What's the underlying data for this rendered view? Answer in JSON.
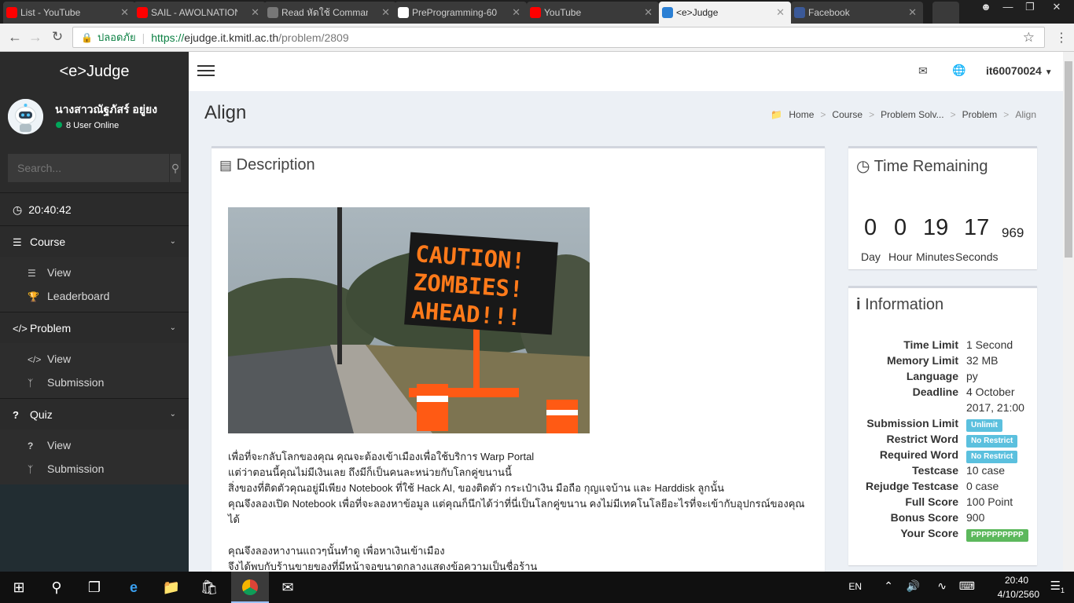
{
  "browser": {
    "tabs": [
      {
        "title": "List - YouTube",
        "icon": "youtube-icon",
        "color": "#ff0000"
      },
      {
        "title": "SAIL - AWOLNATION",
        "icon": "youtube-icon",
        "color": "#ff0000"
      },
      {
        "title": "Read หัดใช้ Command",
        "icon": "book-icon",
        "color": "#777777"
      },
      {
        "title": "PreProgramming-60",
        "icon": "github-icon",
        "color": "#ffffff"
      },
      {
        "title": "YouTube",
        "icon": "youtube-icon",
        "color": "#ff0000"
      },
      {
        "title": "<e>Judge",
        "icon": "itkmitl-icon",
        "color": "#2a7fd4"
      },
      {
        "title": "Facebook",
        "icon": "facebook-icon",
        "color": "#3b5998"
      }
    ],
    "address": {
      "secure_label": "ปลอดภัย",
      "scheme": "https://",
      "host": "ejudge.it.kmitl.ac.th",
      "path": "/problem/2809"
    }
  },
  "sidebar": {
    "logo": "<e>Judge",
    "user_name": "นางสาวณัฐภัสร์ อยู่ยง",
    "online": "8 User Online",
    "search_placeholder": "Search...",
    "clock": "20:40:42",
    "sections": [
      {
        "label": "Course",
        "items": [
          "View",
          "Leaderboard"
        ]
      },
      {
        "label": "Problem",
        "items": [
          "View",
          "Submission"
        ]
      },
      {
        "label": "Quiz",
        "items": [
          "View",
          "Submission"
        ]
      }
    ]
  },
  "topnav": {
    "user": "it60070024"
  },
  "page": {
    "title": "Align",
    "breadcrumb": [
      "Home",
      "Course",
      "Problem Solv...",
      "Problem",
      "Align"
    ]
  },
  "description": {
    "heading": "Description",
    "sign_text": [
      "CAUTION!",
      "ZOMBIES!",
      "AHEAD!!!"
    ],
    "paragraphs": [
      "เพื่อที่จะกลับโลกของคุณ คุณจะต้องเข้าเมืองเพื่อใช้บริการ Warp Portal",
      "แต่ว่าตอนนี้คุณไม่มีเงินเลย ถึงมีก็เป็นคนละหน่วยกับโลกคู่ขนานนี้",
      "สิ่งของที่ติดตัวคุณอยู่มีเพียง Notebook ที่ใช้ Hack AI, ของติดตัว กระเป๋าเงิน มือถือ กุญแจบ้าน และ Harddisk ลูกนั้น",
      "คุณจึงลองเปิด Notebook เพื่อที่จะลองหาข้อมูล แต่คุณก็นึกได้ว่าที่นี่เป็นโลกคู่ขนาน คงไม่มีเทคโนโลยีอะไรที่จะเข้ากับอุปกรณ์ของคุณได้",
      "",
      "คุณจึงลองหางานแถวๆนั้นทำดู เพื่อหาเงินเข้าเมือง",
      "จึงได้พบกับร้านขายของที่มีหน้าจอขนาดกลางแสดงข้อความเป็นชื่อร้าน"
    ]
  },
  "time_remaining": {
    "heading": "Time Remaining",
    "day": "0",
    "hour": "0",
    "minutes": "19",
    "seconds": "17",
    "ms": "969",
    "labels": {
      "day": "Day",
      "hour": "Hour",
      "minutes": "Minutes",
      "seconds": "Seconds"
    }
  },
  "information": {
    "heading": "Information",
    "rows": [
      {
        "k": "Time Limit",
        "v": "1 Second"
      },
      {
        "k": "Memory Limit",
        "v": "32 MB"
      },
      {
        "k": "Language",
        "v": "py"
      },
      {
        "k": "Deadline",
        "v": "4 October",
        "v2": "2017, 21:00"
      },
      {
        "k": "Submission Limit",
        "badge": "Unlimit",
        "color": "#5bc0de"
      },
      {
        "k": "Restrict Word",
        "badge": "No Restrict",
        "color": "#5bc0de"
      },
      {
        "k": "Required Word",
        "badge": "No Restrict",
        "color": "#5bc0de"
      },
      {
        "k": "Testcase",
        "v": "10 case"
      },
      {
        "k": "Rejudge Testcase",
        "v": "0 case"
      },
      {
        "k": "Full Score",
        "v": "100 Point"
      },
      {
        "k": "Bonus Score",
        "v": "900"
      },
      {
        "k": "Your Score",
        "badge": "PPPPPPPPPP",
        "color": "#5cb85c"
      }
    ]
  },
  "taskbar": {
    "lang": "EN",
    "time": "20:40",
    "date": "4/10/2560",
    "notif": "1"
  }
}
